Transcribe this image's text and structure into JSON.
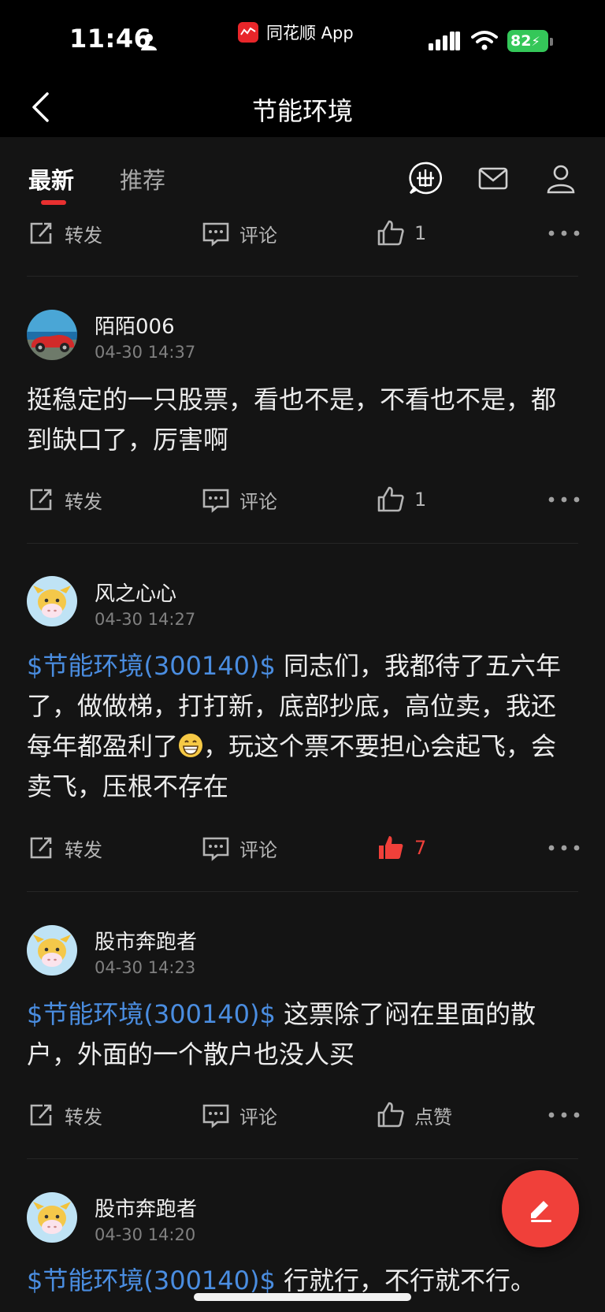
{
  "status_bar": {
    "time": "11:46",
    "app_name": "同花顺 App",
    "battery": "82"
  },
  "nav": {
    "title": "节能环境"
  },
  "tabs": [
    {
      "label": "最新",
      "active": true
    },
    {
      "label": "推荐",
      "active": false
    }
  ],
  "header_icons": [
    "ths-logo-icon",
    "mail-icon",
    "user-icon"
  ],
  "actions": {
    "forward": "转发",
    "comment": "评论",
    "like": "点赞"
  },
  "top_partial": {
    "like_count": "1"
  },
  "posts": [
    {
      "user": "陌陌006",
      "time": "04-30 14:37",
      "stock_tag": "",
      "text": "挺稳定的一只股票，看也不是，不看也不是，都到缺口了，厉害啊",
      "like_count": "1",
      "liked": false
    },
    {
      "user": "风之心心",
      "time": "04-30 14:27",
      "stock_tag": "$节能环境(300140)$",
      "text_before_emoji": " 同志们，我都待了五六年了，做做梯，打打新，底部抄底，高位卖，我还每年都盈利了",
      "text_after_emoji": "，玩这个票不要担心会起飞，会卖飞，压根不存在",
      "like_count": "7",
      "liked": true
    },
    {
      "user": "股市奔跑者",
      "time": "04-30 14:23",
      "stock_tag": "$节能环境(300140)$",
      "text": " 这票除了闷在里面的散户，外面的一个散户也没人买",
      "like_count": "",
      "liked": false
    },
    {
      "user": "股市奔跑者",
      "time": "04-30 14:20",
      "stock_tag": "$节能环境(300140)$",
      "text": " 行就行，不行就不行。"
    }
  ],
  "colors": {
    "background": "#141414",
    "accent_red": "#f0403a",
    "stock_link": "#4a8de0"
  }
}
